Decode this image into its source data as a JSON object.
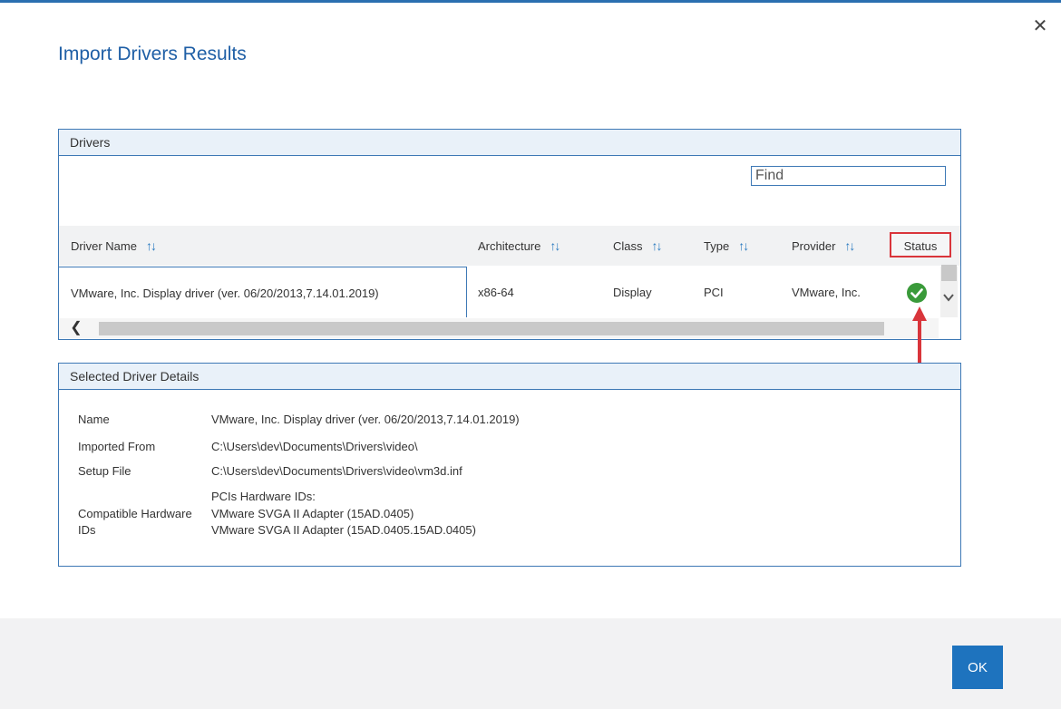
{
  "dialog": {
    "title": "Import Drivers Results",
    "close_icon": "close-icon",
    "accent_color": "#1e73be",
    "ok_label": "OK"
  },
  "drivers": {
    "header": "Drivers",
    "find_placeholder": "Find",
    "columns": {
      "driver_name": "Driver Name",
      "architecture": "Architecture",
      "class": "Class",
      "type": "Type",
      "provider": "Provider",
      "status": "Status"
    },
    "sort_icon": "sort-icon",
    "rows": [
      {
        "name": "VMware, Inc. Display driver (ver. 06/20/2013,7.14.01.2019)",
        "architecture": "x86-64",
        "class": "Display",
        "type": "PCI",
        "provider": "VMware, Inc.",
        "status_icon": "check-circle-icon",
        "status_color": "#3a9a3a"
      }
    ],
    "highlight_color": "#d9353b"
  },
  "details": {
    "header": "Selected Driver Details",
    "name_label": "Name",
    "name_value": "VMware, Inc. Display driver (ver. 06/20/2013,7.14.01.2019)",
    "imported_label": "Imported From",
    "imported_value": "C:\\Users\\dev\\Documents\\Drivers\\video\\",
    "setup_label": "Setup File",
    "setup_value": "C:\\Users\\dev\\Documents\\Drivers\\video\\vm3d.inf",
    "hardware_label_1": "Compatible Hardware",
    "hardware_label_2": "IDs",
    "hardware_line_1": "PCIs Hardware IDs:",
    "hardware_line_2": "VMware SVGA II Adapter (15AD.0405)",
    "hardware_line_3": "VMware SVGA II Adapter (15AD.0405.15AD.0405)"
  }
}
